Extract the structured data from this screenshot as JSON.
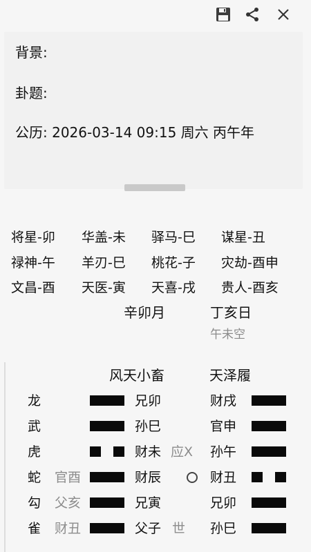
{
  "toolbar": {
    "save_icon": "save-icon",
    "share_icon": "share-icon",
    "close_icon": "close-icon"
  },
  "info": {
    "background_label": "背景:",
    "title_label": "卦题:",
    "date_line": "公历: 2026-03-14  09:15  周六 丙午年"
  },
  "shensha": [
    [
      "将星-卯",
      "华盖-未",
      "驿马-巳",
      "谋星-丑"
    ],
    [
      "禄神-午",
      "羊刃-巳",
      "桃花-子",
      "灾劫-酉申"
    ],
    [
      "文昌-酉",
      "天医-寅",
      "天喜-戌",
      "贵人-酉亥"
    ]
  ],
  "pillars": {
    "month": "辛卯月",
    "day": "丁亥日",
    "kong": "午未空"
  },
  "gua": {
    "main": "风天小畜",
    "changed": "天泽履"
  },
  "yao": [
    {
      "god": "龙",
      "fushen": "",
      "line": "yang",
      "main": "兄卯",
      "mark": "",
      "changed": "财戌",
      "cline": "yang"
    },
    {
      "god": "武",
      "fushen": "",
      "line": "yang",
      "main": "孙巳",
      "mark": "",
      "changed": "官申",
      "cline": "yang"
    },
    {
      "god": "虎",
      "fushen": "",
      "line": "yin",
      "main": "财未",
      "mark": "应X",
      "changed": "孙午",
      "cline": "yang"
    },
    {
      "god": "蛇",
      "fushen": "官酉",
      "line": "yang",
      "main": "财辰",
      "mark": "O",
      "changed": "财丑",
      "cline": "yin"
    },
    {
      "god": "勾",
      "fushen": "父亥",
      "line": "yang",
      "main": "兄寅",
      "mark": "",
      "changed": "兄卯",
      "cline": "yang"
    },
    {
      "god": "雀",
      "fushen": "财丑",
      "line": "yang",
      "main": "父子",
      "mark": "世",
      "changed": "孙巳",
      "cline": "yang"
    }
  ]
}
